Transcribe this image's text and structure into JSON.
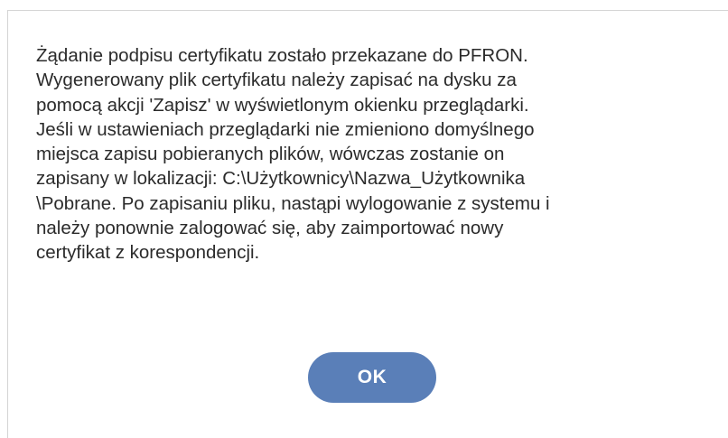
{
  "dialog": {
    "message_lines": [
      "Żądanie podpisu certyfikatu zostało przekazane do PFRON.",
      "Wygenerowany plik certyfikatu należy zapisać na dysku za",
      "pomocą akcji 'Zapisz' w wyświetlonym okienku przeglądarki.",
      "Jeśli w ustawieniach przeglądarki nie zmieniono domyślnego",
      "miejsca zapisu pobieranych plików, wówczas zostanie on",
      "zapisany w lokalizacji: C:\\Użytkownicy\\Nazwa_Użytkownika",
      "\\Pobrane. Po zapisaniu pliku, nastąpi wylogowanie z systemu i",
      "należy ponownie zalogować się, aby zaimportować nowy",
      "certyfikat z korespondencji."
    ],
    "ok_label": "OK"
  },
  "colors": {
    "button_bg": "#5a7fb8",
    "button_text": "#ffffff",
    "text": "#2b2b2b",
    "border": "#d4d4d4"
  }
}
